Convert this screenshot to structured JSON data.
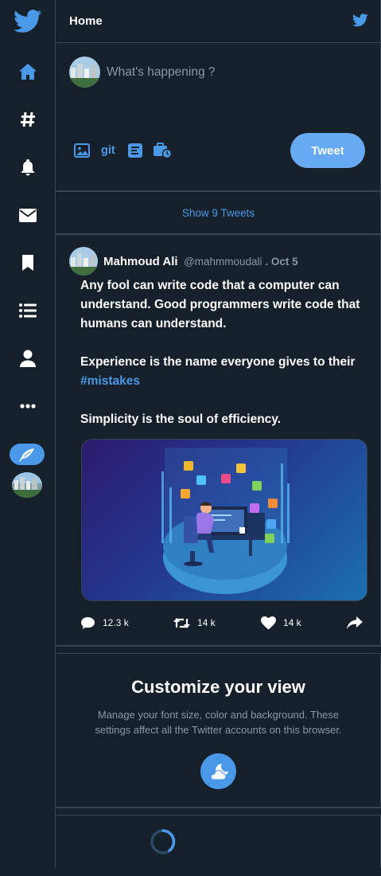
{
  "app": {
    "title": "Home",
    "accent": "#4a99e9",
    "background": "#15202b"
  },
  "sidebar": {
    "items": [
      {
        "name": "logo",
        "icon": "twitter-bird-icon"
      },
      {
        "name": "home",
        "icon": "home-icon"
      },
      {
        "name": "explore",
        "icon": "hashtag-icon"
      },
      {
        "name": "notifications",
        "icon": "bell-icon"
      },
      {
        "name": "messages",
        "icon": "envelope-icon"
      },
      {
        "name": "bookmarks",
        "icon": "bookmark-icon"
      },
      {
        "name": "lists",
        "icon": "list-icon"
      },
      {
        "name": "profile",
        "icon": "user-icon"
      },
      {
        "name": "more",
        "icon": "more-icon"
      },
      {
        "name": "compose",
        "icon": "feather-icon"
      }
    ]
  },
  "header": {
    "title": "Home"
  },
  "composer": {
    "placeholder": "What's happening ?",
    "tools": [
      {
        "icon": "image-icon"
      },
      {
        "label": "git"
      },
      {
        "icon": "poll-icon"
      },
      {
        "icon": "schedule-icon"
      }
    ],
    "tweet_button": "Tweet"
  },
  "feed": {
    "show_tweets": "Show 9 Tweets"
  },
  "tweet": {
    "author": "Mahmoud Ali",
    "handle": "@mahmmoudali",
    "date": " . Oct 5",
    "lines": {
      "p1": "Any fool can write code that a computer can understand. Good programmers write code that humans can understand.",
      "p2": "Experience is the name everyone gives to their",
      "hashtag": "#mistakes",
      "p3": "Simplicity is the soul of efficiency."
    },
    "actions": {
      "replies": "12.3 k",
      "retweets": "14 k",
      "likes": "14 k"
    }
  },
  "customize": {
    "title": "Customize your view",
    "description": "Manage your font size, color and background. These settings affect all the Twitter accounts on this browser."
  }
}
